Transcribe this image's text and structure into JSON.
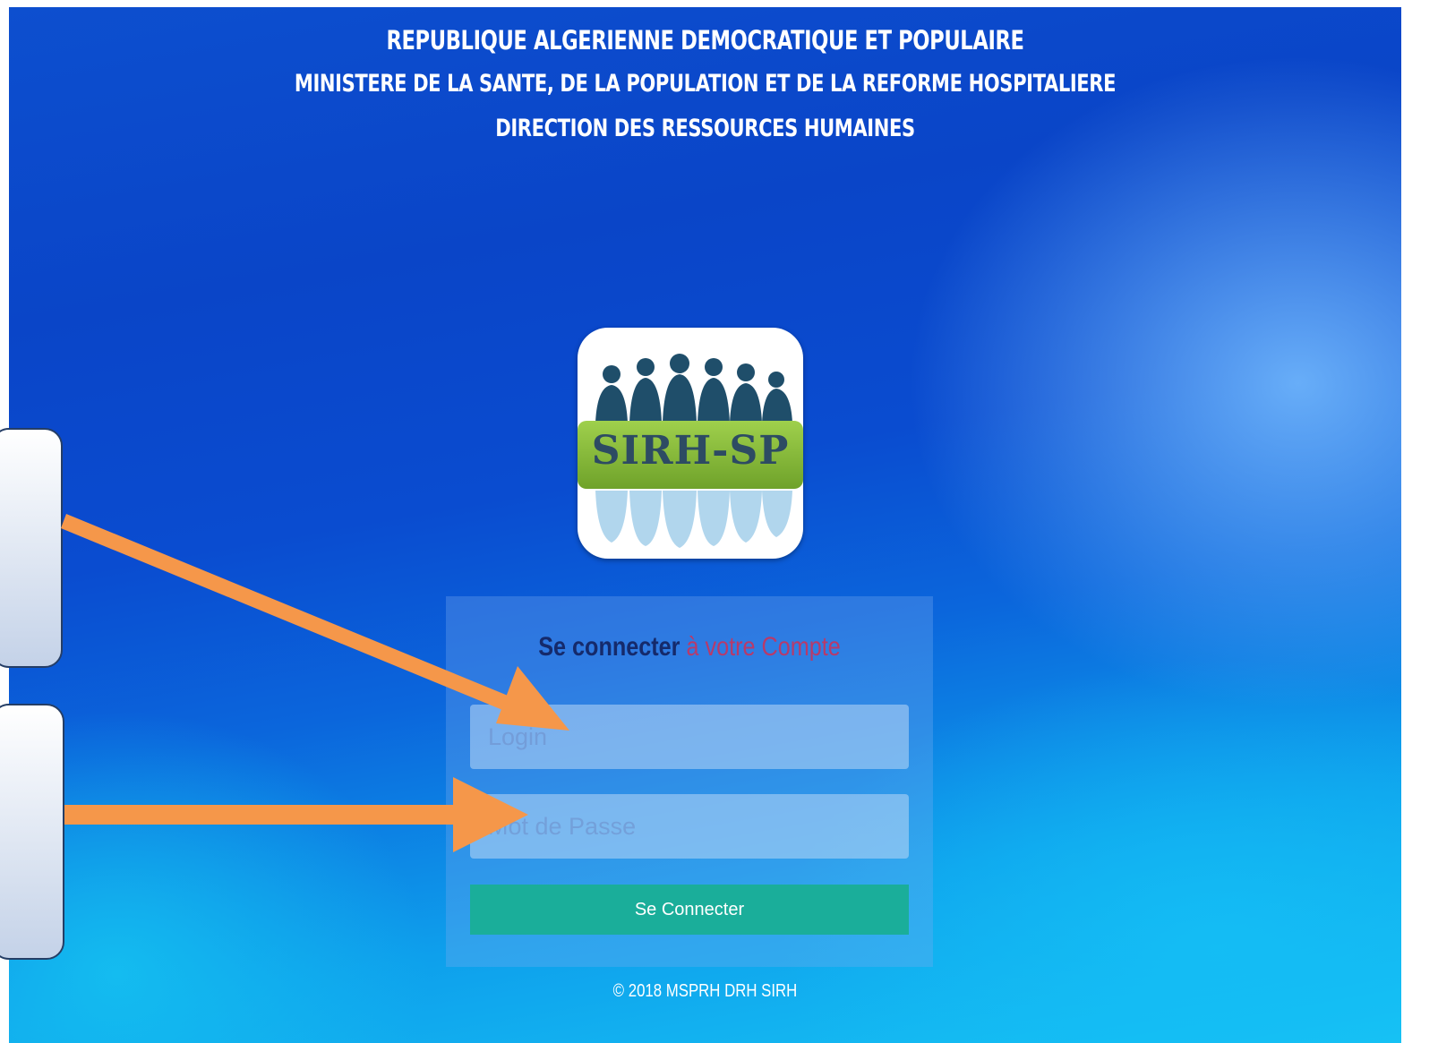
{
  "header": {
    "line1": "REPUBLIQUE ALGERIENNE DEMOCRATIQUE ET POPULAIRE",
    "line2": "MINISTERE DE LA SANTE, DE LA POPULATION ET DE LA REFORME HOSPITALIERE",
    "line3": "DIRECTION DES RESSOURCES HUMAINES"
  },
  "logo": {
    "text": "SIRH-SP",
    "icon": "people-silhouettes-icon"
  },
  "form": {
    "title_strong": "Se connecter",
    "title_soft": " à votre Compte",
    "login_placeholder": "Login",
    "password_placeholder": "Mot de Passe",
    "submit_label": "Se Connecter"
  },
  "footer": {
    "text": "© 2018 MSPRH DRH SIRH"
  },
  "colors": {
    "background_top": "#0a45c8",
    "background_bottom": "#17c4f4",
    "button": "#1aae9a",
    "title_strong": "#152a6b",
    "title_soft": "#b83a6a",
    "annotation_arrow": "#f5974a"
  }
}
